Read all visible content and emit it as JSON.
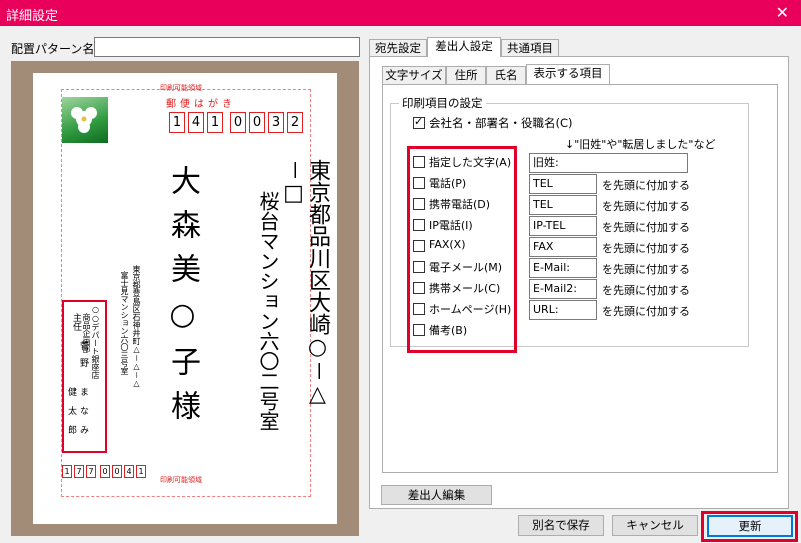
{
  "window": {
    "title": "詳細設定",
    "close": "✕"
  },
  "pattern": {
    "label": "配置パターン名",
    "value": ""
  },
  "main_tabs": [
    {
      "label": "宛先設定"
    },
    {
      "label": "差出人設定"
    },
    {
      "label": "共通項目"
    }
  ],
  "sub_tabs": [
    {
      "label": "文字サイズ"
    },
    {
      "label": "住所"
    },
    {
      "label": "氏名"
    },
    {
      "label": "表示する項目"
    }
  ],
  "print_items": {
    "group_label": "印刷項目の設定",
    "company": {
      "label": "会社名・部署名・役職名(C)",
      "checked": true
    },
    "hint": "↓\"旧姓\"や\"転居しました\"など",
    "suffix": "を先頭に付加する",
    "rows": [
      {
        "label": "指定した文字(A)",
        "value": "旧姓:",
        "checked": false
      },
      {
        "label": "電話(P)",
        "value": "TEL",
        "checked": false
      },
      {
        "label": "携帯電話(D)",
        "value": "TEL",
        "checked": false
      },
      {
        "label": "IP電話(I)",
        "value": "IP-TEL",
        "checked": false
      },
      {
        "label": "FAX(X)",
        "value": "FAX",
        "checked": false
      },
      {
        "label": "電子メール(M)",
        "value": "E-Mail:",
        "checked": false
      },
      {
        "label": "携帯メール(C)",
        "value": "E-Mail2:",
        "checked": false
      },
      {
        "label": "ホームページ(H)",
        "value": "URL:",
        "checked": false
      },
      {
        "label": "備考(B)",
        "value": "",
        "checked": false
      }
    ]
  },
  "buttons": {
    "edit_sender": "差出人編集",
    "save_as": "別名で保存",
    "cancel": "キャンセル",
    "update": "更新"
  },
  "card": {
    "print_area_top": "印刷可能領域",
    "print_area_bottom": "印刷可能領域",
    "header": "郵便はがき",
    "zip": [
      "1",
      "4",
      "1",
      "0",
      "0",
      "3",
      "2"
    ],
    "address1": "東京都品川区大崎○－△－□",
    "address2": "桜台マンション六〇二号室",
    "recipient": "大森美○子様",
    "sender_address1": "東京都豊島区石神井町△－△－△",
    "sender_address2": "富士見マンション六〇三号室",
    "sender_company1": "○○デパート銀座店",
    "sender_company2": "商品企画部",
    "sender_title": "主任",
    "sender_name_a": "菅野",
    "sender_name_b": "健太郎",
    "sender_name_c": "まなみ",
    "sender_zip": [
      "1",
      "7",
      "7",
      "0",
      "0",
      "4",
      "1"
    ]
  },
  "colors": {
    "titlebar": "#e8005a",
    "highlight": "#e0002a",
    "accent": "#0078d7"
  }
}
